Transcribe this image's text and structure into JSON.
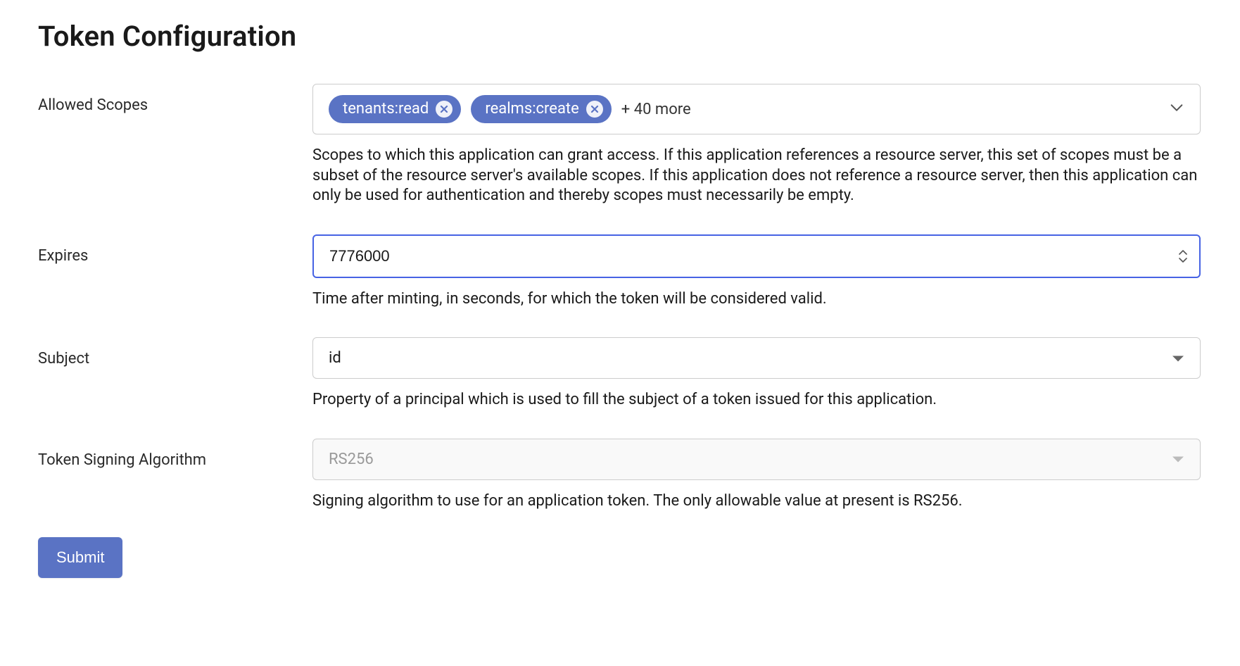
{
  "page": {
    "title": "Token Configuration"
  },
  "form": {
    "allowed_scopes": {
      "label": "Allowed Scopes",
      "chips": [
        "tenants:read",
        "realms:create"
      ],
      "more_count": 40,
      "more_text": "+ 40 more",
      "help": "Scopes to which this application can grant access. If this application references a resource server, this set of scopes must be a subset of the resource server's available scopes. If this application does not reference a resource server, then this application can only be used for authentication and thereby scopes must necessarily be empty."
    },
    "expires": {
      "label": "Expires",
      "value": "7776000",
      "help": "Time after minting, in seconds, for which the token will be considered valid."
    },
    "subject": {
      "label": "Subject",
      "value": "id",
      "help": "Property of a principal which is used to fill the subject of a token issued for this application."
    },
    "token_signing_algorithm": {
      "label": "Token Signing Algorithm",
      "value": "RS256",
      "help": "Signing algorithm to use for an application token. The only allowable value at present is RS256.",
      "disabled": true
    },
    "submit": {
      "label": "Submit"
    }
  }
}
